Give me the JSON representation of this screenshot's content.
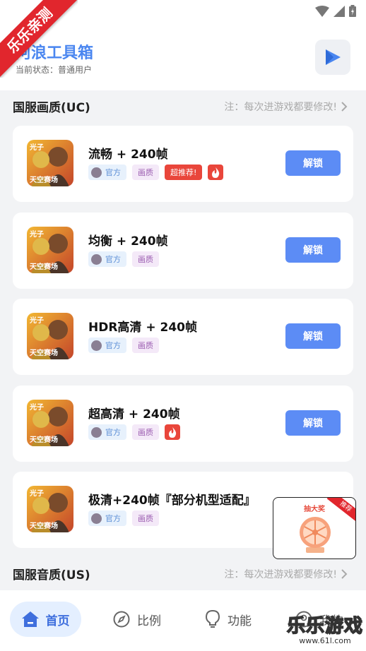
{
  "ribbon": {
    "text": "乐乐亲测"
  },
  "header": {
    "app_title": "阿浪工具箱",
    "user_status": "当前状态：普通用户"
  },
  "sections": [
    {
      "title": "国服画质(UC)",
      "note": "注：每次进游戏都要修改!"
    },
    {
      "title": "国服音质(US)",
      "note": "注：每次进游戏都要修改!"
    }
  ],
  "cards": [
    {
      "name": "流畅 + 240帧",
      "tag_official": "官方",
      "tag_quality": "画质",
      "tag_hot": "超推荐!",
      "fire": true,
      "button": "解锁"
    },
    {
      "name": "均衡 + 240帧",
      "tag_official": "官方",
      "tag_quality": "画质",
      "button": "解锁"
    },
    {
      "name": "HDR高清 + 240帧",
      "tag_official": "官方",
      "tag_quality": "画质",
      "button": "解锁"
    },
    {
      "name": "超高清 + 240帧",
      "tag_official": "官方",
      "tag_quality": "画质",
      "fire": true,
      "button": "解锁"
    },
    {
      "name": "极清+240帧『部分机型适配』",
      "tag_official": "官方",
      "tag_quality": "画质"
    }
  ],
  "thumb_text": {
    "top": "光子",
    "bottom": "天空赛场"
  },
  "lottery": {
    "title": "抽大奖",
    "corner": "推荐"
  },
  "nav": [
    {
      "label": "首页",
      "icon": "home-icon",
      "active": true
    },
    {
      "label": "比例",
      "icon": "compass-icon"
    },
    {
      "label": "功能",
      "icon": "lightbulb-icon"
    },
    {
      "label": "我的",
      "icon": "user-icon"
    }
  ],
  "watermark": {
    "big": "乐乐游戏",
    "small": "www.61l.com"
  },
  "colors": {
    "accent": "#5c8cf5",
    "title_blue": "#4a86f0",
    "hot_red": "#e9463b",
    "ribbon_red": "#e1262d"
  }
}
